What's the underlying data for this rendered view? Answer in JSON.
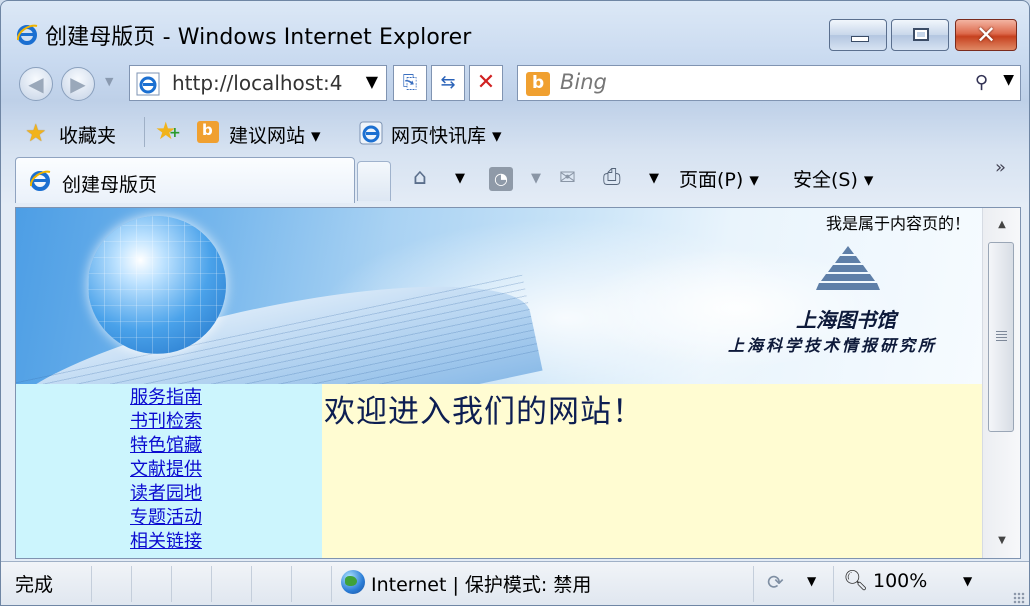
{
  "window": {
    "title": "创建母版页 - Windows Internet Explorer"
  },
  "addressbar": {
    "url": "http://localhost:4",
    "search_placeholder": "Bing"
  },
  "favorites": {
    "label": "收藏夹",
    "suggested_sites": "建议网站 ▾",
    "web_slice_gallery": "网页快讯库 ▾"
  },
  "tabs": [
    {
      "label": "创建母版页"
    }
  ],
  "commandbar": {
    "page": "页面(P) ▾",
    "safety": "安全(S) ▾"
  },
  "page": {
    "header_note": "我是属于内容页的！",
    "library_name": "上海图书馆",
    "institute_name": "上海科学技术情报研究所",
    "welcome": "欢迎进入我们的网站！",
    "nav_links": [
      "服务指南",
      "书刊检索",
      "特色馆藏",
      "文献提供",
      "读者园地",
      "专题活动",
      "相关链接"
    ]
  },
  "statusbar": {
    "status": "完成",
    "zone": "Internet | 保护模式: 禁用",
    "zoom": "100%"
  },
  "icons": {
    "ie": "ie-logo-icon",
    "favorites": "star-icon",
    "home": "home-icon",
    "feeds": "rss-icon",
    "mail": "mail-icon",
    "print": "printer-icon"
  }
}
